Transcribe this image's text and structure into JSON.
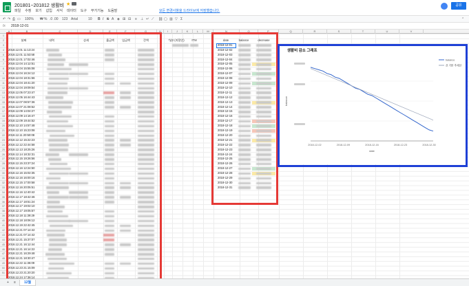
{
  "app": {
    "doc_title": "201801~201812 생활비",
    "saved_message": "모든 변경사항을 드라이브에 저장했습니다.",
    "share_label": "공유",
    "menu": [
      "파일",
      "수정",
      "보기",
      "삽입",
      "서식",
      "데이터",
      "도구",
      "부가기능",
      "도움말"
    ]
  },
  "toolbar": {
    "zoom": "100%",
    "currency": "₩",
    "percent": "%",
    "decimals": ".0 .00",
    "format_123": "123",
    "font": "Arial",
    "font_size": "10"
  },
  "formula_bar": {
    "fx_label": "fx",
    "value": "2018-12-01"
  },
  "columns": [
    "A",
    "B",
    "C",
    "D",
    "E",
    "F",
    "G",
    "H",
    "I",
    "J",
    "K",
    "L",
    "M",
    "N",
    "O",
    "P",
    "Q",
    "R",
    "S",
    "T",
    "U",
    "V"
  ],
  "left_table": {
    "headers": [
      "날짜",
      "내역",
      "상세",
      "출금액",
      "입금액",
      "잔액"
    ],
    "dates": [
      "2018.12.01 11:13:24",
      "2018.12.01 11:53:58",
      "2018.12.01 17:02:46",
      "2018.12.04 14:12:51",
      "2018.12.04 15:55:08",
      "2018.12.04 16:24:12",
      "2018.12.04 18:31:56",
      "2018.12.04 18:41:20",
      "2018.12.04 19:09:54",
      "2018.12.05 07:23:47",
      "2018.12.05 16:44:43",
      "2018.12.07 08:57:36",
      "2018.12.07 21:08:52",
      "2018.12.09 14:04:27",
      "2018.12.09 14:16:47",
      "2018.12.09 19:44:52",
      "2018.12.10 14:57:48",
      "2018.12.10 15:23:08",
      "2018.12.11 20:50:08",
      "2018.12.12 15:22:23",
      "2018.12.12 22:44:58",
      "2018.12.13 18:25:26",
      "2018.12.14 18:32:31",
      "2018.12.15 19:26:56",
      "2018.12.15 23:37:24",
      "2018.12.16 12:24:50",
      "2018.12.16 15:02:35",
      "2018.12.16 16:00:16",
      "2018.12.15 17:00:58",
      "2018.12.16 20:05:51",
      "2018.12.16 12:40:42",
      "2018.12.17 18:42:46",
      "2018.12.17 18:51:24",
      "2018.12.17 19:02:10",
      "2018.12.17 19:05:57",
      "2018.12.18 11:39:29",
      "2018.12.18 18:06:12",
      "2018.12.19 22:42:45",
      "2018.12.21 07:14:42",
      "2018.12.21 07:14:42",
      "2018.12.21 15:37:07",
      "2018.12.21 16:12:44",
      "2018.12.21 16:14:22",
      "2018.12.21 16:29:48",
      "2018.12.21 18:30:47",
      "2018.12.22 11:36:09",
      "2018.12.23 21:15:09",
      "2018.12.23 21:20:20",
      "2018.12.24 17:36:14"
    ],
    "extra_headers": [
      "*날2 (지정인)",
      "ITM"
    ]
  },
  "right_table": {
    "headers": [
      "date",
      "balance",
      "decrease"
    ],
    "dates": [
      "2018-12-01",
      "2018-12-02",
      "2018-12-03",
      "2018-12-04",
      "2018-12-05",
      "2018-12-06",
      "2018-12-07",
      "2018-12-08",
      "2018-12-09",
      "2018-12-10",
      "2018-12-11",
      "2018-12-12",
      "2018-12-13",
      "2018-12-14",
      "2018-12-15",
      "2018-12-16",
      "2018-12-17",
      "2018-12-18",
      "2018-12-19",
      "2018-12-20",
      "2018-12-21",
      "2018-12-22",
      "2018-12-23",
      "2018-12-24",
      "2018-12-25",
      "2018-12-26",
      "2018-12-27",
      "2018-12-28",
      "2018-12-29",
      "2018-12-30",
      "2018-12-31"
    ]
  },
  "chart_data": {
    "type": "line",
    "title": "생활비 감소 그래프",
    "xlabel": "date",
    "ylabel": "balance",
    "x_ticks": [
      "2018-12-02",
      "2018-12-09",
      "2018-12-16",
      "2018-12-23",
      "2018-12-30"
    ],
    "legend_placement": "top-right",
    "series": [
      {
        "name": "balance",
        "color": "#3366cc",
        "values": [
          100,
          99,
          98,
          97,
          95,
          94,
          92,
          91,
          89,
          87,
          85,
          83,
          82,
          80,
          78,
          77,
          75,
          73,
          71,
          69,
          67,
          65,
          63,
          61,
          59,
          57,
          55,
          53,
          51,
          49,
          48
        ]
      },
      {
        "name": "선 기반 추세선",
        "color": "#9aa4b8",
        "values": [
          99,
          97.6,
          96.2,
          94.8,
          93.4,
          92,
          90.6,
          89.2,
          87.8,
          86.4,
          85,
          83.6,
          82.2,
          80.8,
          79.4,
          78,
          76.6,
          75.2,
          73.8,
          72.4,
          71,
          69.6,
          68.2,
          66.8,
          65.4,
          64,
          62.6,
          61.2,
          59.8,
          58.4,
          57
        ]
      }
    ],
    "ylim": [
      40,
      105
    ]
  },
  "tabs": [
    "+",
    "≡",
    "12월"
  ]
}
